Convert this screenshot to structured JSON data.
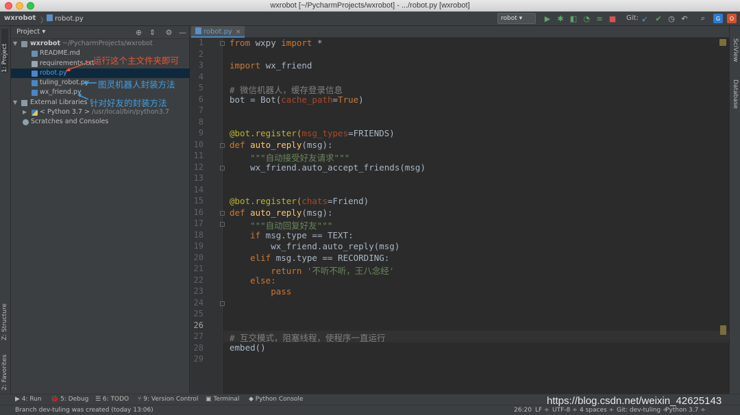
{
  "window": {
    "title": "wxrobot [~/PycharmProjects/wxrobot] - .../robot.py [wxrobot]"
  },
  "breadcrumb": {
    "root": "wxrobot",
    "separator": "〉",
    "file": "robot.py"
  },
  "toolbar": {
    "run_config": "robot ▾",
    "git_label": "Git:"
  },
  "left_stripe": {
    "project_tab": "1: Project",
    "structure_tab": "Z: Structure",
    "favorites_tab": "2: Favorites"
  },
  "right_stripe": {
    "sciview_tab": "SciView",
    "database_tab": "Database"
  },
  "project_panel": {
    "title": "Project ▾",
    "tree": [
      {
        "label": "wxrobot",
        "extra": " ~/PycharmProjects/wxrobot",
        "icon": "folder-icon"
      },
      {
        "label": "README.md",
        "icon": "markdown-file-icon"
      },
      {
        "label": "requirements.txt",
        "icon": "text-file-icon"
      },
      {
        "label": "robot.py",
        "icon": "python-file-icon"
      },
      {
        "label": "tuling_robot.py",
        "icon": "python-file-icon"
      },
      {
        "label": "wx_friend.py",
        "icon": "python-file-icon"
      },
      {
        "label": "External Libraries",
        "icon": "library-icon"
      },
      {
        "label": "< Python 3.7 >",
        "extra": " /usr/local/bin/python3.7",
        "icon": "python-sdk-icon"
      },
      {
        "label": "Scratches and Consoles",
        "icon": "scratch-icon"
      }
    ]
  },
  "annotations": {
    "robot": "运行这个主文件夹即可",
    "tuling": "图灵机器人封装方法",
    "friend": "针对好友的封装方法"
  },
  "editor": {
    "tab_label": "robot.py",
    "current_line": 26,
    "line_numbers": [
      "1",
      "2",
      "3",
      "4",
      "5",
      "6",
      "7",
      "8",
      "9",
      "10",
      "11",
      "12",
      "13",
      "14",
      "15",
      "16",
      "17",
      "18",
      "19",
      "20",
      "21",
      "22",
      "23",
      "24",
      "25",
      "26",
      "27",
      "28",
      "29"
    ],
    "code": {
      "l1_from": "from",
      "l1_mod": " wxpy ",
      "l1_import": "import",
      "l1_star": " *",
      "l3_import": "import",
      "l3_mod": " wx_friend",
      "l5": "# 微信机器人，缓存登录信息",
      "l6_a": "bot = Bot(",
      "l6_param": "cache_path",
      "l6_eq": "=",
      "l6_true": "True",
      "l6_close": ")",
      "l9_dec": "@bot.register(",
      "l9_param": "msg_types",
      "l9_rest": "=FRIENDS)",
      "l10_def": "def",
      "l10_fn": " auto_reply",
      "l10_rest": "(msg):",
      "l11": "    \"\"\"自动接受好友请求\"\"\"",
      "l12": "    wx_friend.auto_accept_friends(msg)",
      "l15_dec": "@bot.register(",
      "l15_param": "chats",
      "l15_rest": "=Friend)",
      "l16_def": "def",
      "l16_fn": " auto_reply",
      "l16_rest": "(msg):",
      "l17": "    \"\"\"自动回复好友\"\"\"",
      "l18_if": "    if",
      "l18_rest": " msg.type == TEXT:",
      "l19": "        wx_friend.auto_reply(msg)",
      "l20_elif": "    elif",
      "l20_rest": " msg.type == RECORDING:",
      "l21_ret": "        return",
      "l21_str": " '不听不听，王八念经'",
      "l22": "    else:",
      "l23": "        pass",
      "l26": "# 互交模式，阻塞线程，使程序一直运行",
      "l27": "embed()"
    }
  },
  "bottom_tools": {
    "run": "▶ 4: Run",
    "debug": "🐞 5: Debug",
    "todo": "☰ 6: TODO",
    "vcs": "⑂ 9: Version Control",
    "terminal": "▣ Terminal",
    "console": "◆ Python Console"
  },
  "status": {
    "message": "Branch dev-tuling was created (today 13:06)",
    "position": "26:20",
    "line_sep": "LF ÷",
    "encoding": "UTF-8 ÷",
    "indent": "4 spaces ÷",
    "git_branch": "Git: dev-tuling ÷",
    "interpreter": "Python 3.7 ÷"
  },
  "watermark": "https://blog.csdn.net/weixin_42625143"
}
